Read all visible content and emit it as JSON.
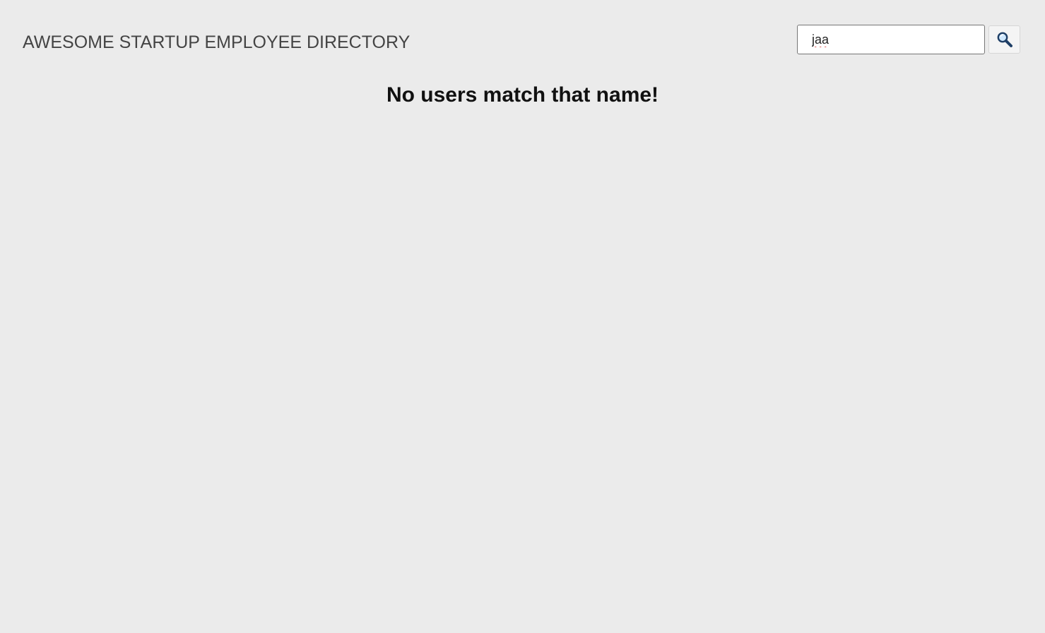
{
  "header": {
    "title": "AWESOME STARTUP EMPLOYEE DIRECTORY"
  },
  "search": {
    "value": "jaa",
    "button_icon": "search-icon"
  },
  "results": {
    "empty_message": "No users match that name!"
  },
  "colors": {
    "background": "#ebebeb",
    "title_text": "#444444",
    "message_text": "#111111",
    "input_border": "#767676",
    "button_background": "#f4f4f4",
    "spellcheck_underline": "#d40000"
  }
}
